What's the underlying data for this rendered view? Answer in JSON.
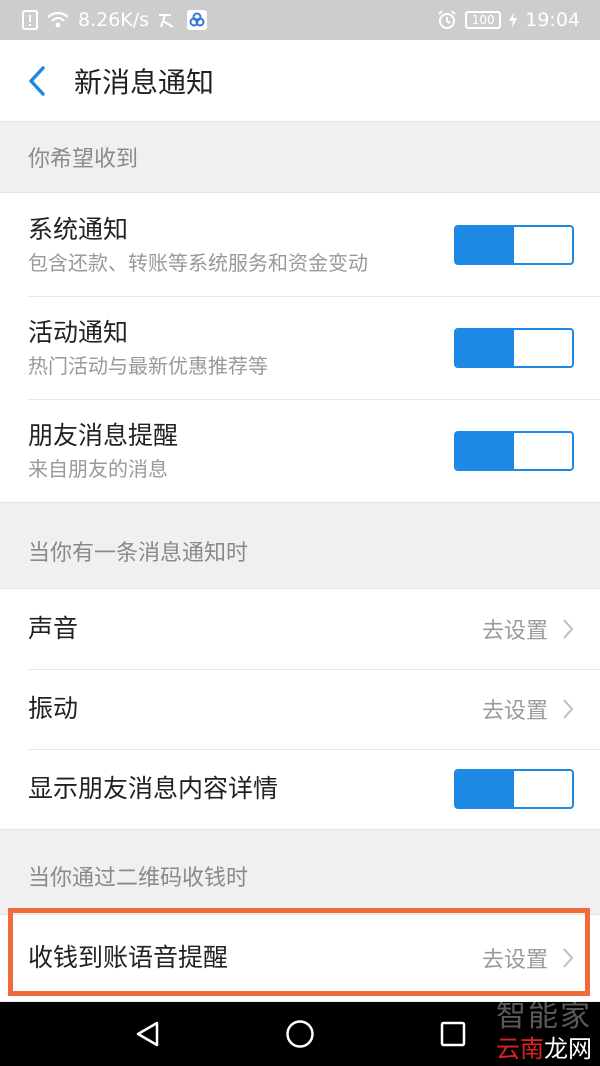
{
  "status_bar": {
    "speed": "8.26K/s",
    "battery": "100",
    "time": "19:04"
  },
  "nav": {
    "title": "新消息通知"
  },
  "sections": {
    "receive_header": "你希望收到",
    "notify_header": "当你有一条消息通知时",
    "qrcode_header": "当你通过二维码收钱时"
  },
  "receive_items": [
    {
      "title": "系统通知",
      "subtitle": "包含还款、转账等系统服务和资金变动",
      "enabled": true
    },
    {
      "title": "活动通知",
      "subtitle": "热门活动与最新优惠推荐等",
      "enabled": true
    },
    {
      "title": "朋友消息提醒",
      "subtitle": "来自朋友的消息",
      "enabled": true
    }
  ],
  "notify_items": {
    "sound": {
      "title": "声音",
      "action": "去设置"
    },
    "vibrate": {
      "title": "振动",
      "action": "去设置"
    },
    "show_details": {
      "title": "显示朋友消息内容详情",
      "enabled": true
    }
  },
  "qrcode_item": {
    "title": "收钱到账语音提醒",
    "action": "去设置"
  },
  "watermark": {
    "top": "智能家",
    "bottom_red": "云南",
    "bottom_white": "龙网"
  },
  "colors": {
    "accent": "#1e88e5",
    "highlight": "#f06a3a"
  }
}
